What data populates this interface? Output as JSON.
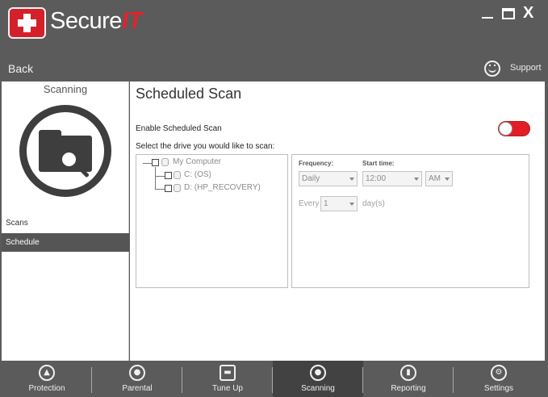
{
  "app": {
    "logo_main": "Secure",
    "logo_accent": "IT",
    "window_close": "X"
  },
  "header": {
    "back_label": "Back",
    "support_label": "Support"
  },
  "sidebar": {
    "title": "Scanning",
    "items": [
      {
        "label": "Scans",
        "active": false
      },
      {
        "label": "Schedule",
        "active": true
      }
    ]
  },
  "main": {
    "title": "Scheduled Scan",
    "enable_label": "Enable Scheduled Scan",
    "enable_toggle_on": false,
    "select_drive_label": "Select the drive you would like to scan:",
    "tree": {
      "root": "My Computer",
      "drives": [
        "C: (OS)",
        "D: (HP_RECOVERY)"
      ]
    },
    "schedule": {
      "frequency_label": "Frequency:",
      "frequency_value": "Daily",
      "start_time_label": "Start time:",
      "time_value": "12:00",
      "ampm_value": "AM",
      "every_label": "Every",
      "every_value": "1",
      "days_label": "day(s)"
    }
  },
  "nav": {
    "items": [
      {
        "label": "Protection",
        "icon": "lock-icon",
        "active": false
      },
      {
        "label": "Parental",
        "icon": "parental-icon",
        "active": false
      },
      {
        "label": "Tune Up",
        "icon": "tuneup-icon",
        "active": false
      },
      {
        "label": "Scanning",
        "icon": "scanning-icon",
        "active": true
      },
      {
        "label": "Reporting",
        "icon": "reporting-icon",
        "active": false
      },
      {
        "label": "Settings",
        "icon": "gear-icon",
        "active": false
      }
    ]
  },
  "colors": {
    "brand_red": "#e2232a",
    "chrome_gray": "#5b5b5b",
    "active_gray": "#424242"
  }
}
